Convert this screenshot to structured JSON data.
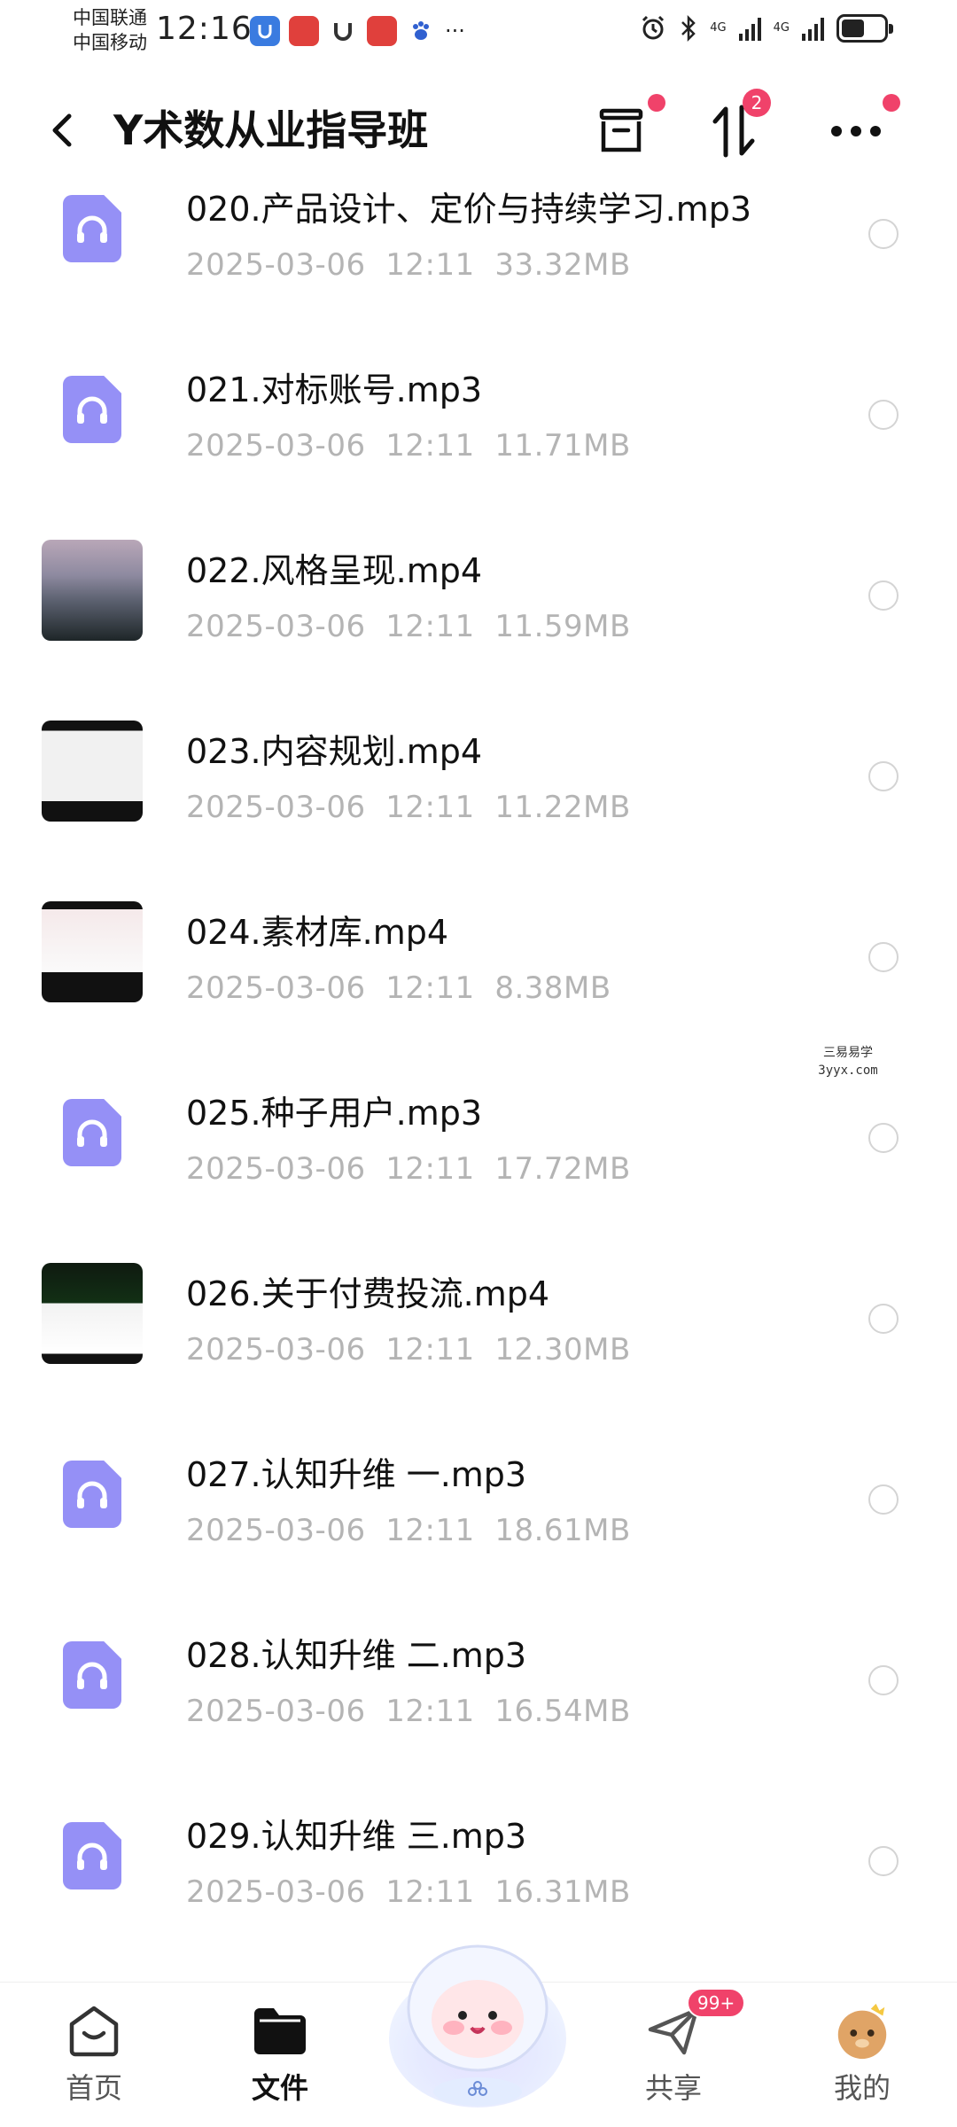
{
  "status_bar": {
    "carrier_1": "中国联通",
    "carrier_2": "中国移动",
    "time": "12:16",
    "network_1": "4G",
    "network_2": "4G",
    "battery_level": 0.55,
    "more_label": "···"
  },
  "header": {
    "title": "Y术数从业指导班",
    "transfer_badge": "2"
  },
  "files": [
    {
      "name": "020.产品设计、定价与持续学习.mp3",
      "date": "2025-03-06",
      "time": "12:11",
      "size": "33.32MB",
      "kind": "audio"
    },
    {
      "name": "021.对标账号.mp3",
      "date": "2025-03-06",
      "time": "12:11",
      "size": "11.71MB",
      "kind": "audio"
    },
    {
      "name": "022.风格呈现.mp4",
      "date": "2025-03-06",
      "time": "12:11",
      "size": "11.59MB",
      "kind": "video"
    },
    {
      "name": "023.内容规划.mp4",
      "date": "2025-03-06",
      "time": "12:11",
      "size": "11.22MB",
      "kind": "video"
    },
    {
      "name": "024.素材库.mp4",
      "date": "2025-03-06",
      "time": "12:11",
      "size": "8.38MB",
      "kind": "video"
    },
    {
      "name": "025.种子用户.mp3",
      "date": "2025-03-06",
      "time": "12:11",
      "size": "17.72MB",
      "kind": "audio"
    },
    {
      "name": "026.关于付费投流.mp4",
      "date": "2025-03-06",
      "time": "12:11",
      "size": "12.30MB",
      "kind": "video"
    },
    {
      "name": "027.认知升维 一.mp3",
      "date": "2025-03-06",
      "time": "12:11",
      "size": "18.61MB",
      "kind": "audio"
    },
    {
      "name": "028.认知升维 二.mp3",
      "date": "2025-03-06",
      "time": "12:11",
      "size": "16.54MB",
      "kind": "audio"
    },
    {
      "name": "029.认知升维 三.mp3",
      "date": "2025-03-06",
      "time": "12:11",
      "size": "16.31MB",
      "kind": "audio"
    }
  ],
  "watermark": {
    "top": "三易易学",
    "bottom": "3yyx.com"
  },
  "bottom_nav": {
    "home": "首页",
    "files": "文件",
    "share": "共享",
    "share_badge": "99+",
    "mine": "我的"
  },
  "colors": {
    "accent": "#f0426a",
    "audio_icon": "#9590f6",
    "meta_text": "#b4b4b4"
  }
}
